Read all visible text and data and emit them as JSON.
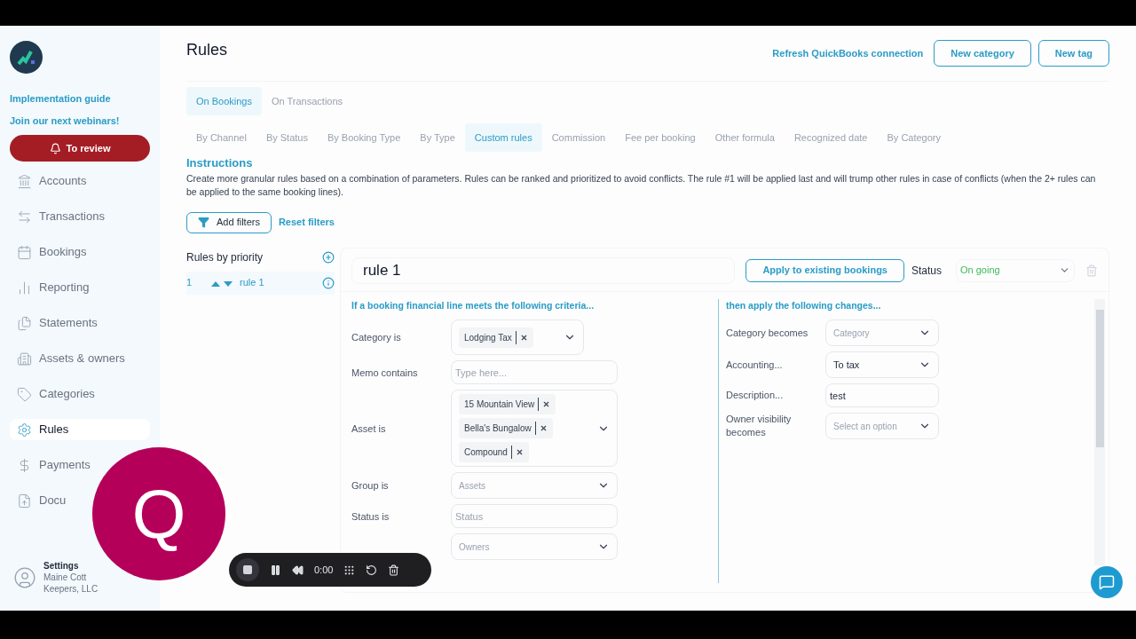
{
  "sidebar": {
    "links": [
      "Implementation guide",
      "Join our next webinars!"
    ],
    "review_button": "To review",
    "nav": [
      {
        "label": "Accounts",
        "selected": false
      },
      {
        "label": "Transactions",
        "selected": false
      },
      {
        "label": "Bookings",
        "selected": false
      },
      {
        "label": "Reporting",
        "selected": false
      },
      {
        "label": "Statements",
        "selected": false
      },
      {
        "label": "Assets & owners",
        "selected": false
      },
      {
        "label": "Categories",
        "selected": false
      },
      {
        "label": "Rules",
        "selected": true
      },
      {
        "label": "Payments",
        "selected": false
      },
      {
        "label": "Docu",
        "selected": false
      }
    ],
    "account": {
      "title": "Settings",
      "lines": [
        "Maine Cott",
        "Keepers, LLC"
      ]
    }
  },
  "header": {
    "title": "Rules",
    "refresh_link": "Refresh QuickBooks connection",
    "buttons": [
      "New category",
      "New tag"
    ]
  },
  "tabs": [
    {
      "label": "On Bookings",
      "selected": true
    },
    {
      "label": "On Transactions",
      "selected": false
    }
  ],
  "subtabs": [
    {
      "label": "By Channel",
      "selected": false
    },
    {
      "label": "By Status",
      "selected": false
    },
    {
      "label": "By Booking Type",
      "selected": false
    },
    {
      "label": "By Type",
      "selected": false
    },
    {
      "label": "Custom rules",
      "selected": true
    },
    {
      "label": "Commission",
      "selected": false
    },
    {
      "label": "Fee per booking",
      "selected": false
    },
    {
      "label": "Other formula",
      "selected": false
    },
    {
      "label": "Recognized date",
      "selected": false
    },
    {
      "label": "By Category",
      "selected": false
    }
  ],
  "instructions": {
    "title": "Instructions",
    "text": "Create more granular rules based on a combination of parameters. Rules can be ranked and prioritized to avoid conflicts. The rule #1 will be applied last and will trump other rules in case of conflicts (when the 2+ rules can be applied to the same booking lines)."
  },
  "filters": {
    "add": "Add filters",
    "reset": "Reset filters"
  },
  "rules_list": {
    "title": "Rules by priority",
    "rules": [
      {
        "rank": "1",
        "name": "rule 1",
        "selected": true
      }
    ]
  },
  "rule": {
    "name": "rule 1",
    "apply_button": "Apply to existing bookings",
    "status_label": "Status",
    "status_value": "On going",
    "criteria_title": "If a booking financial line meets the following criteria...",
    "criteria": [
      {
        "label": "Category is",
        "kind": "tags",
        "tags": [
          "Lodging Tax"
        ]
      },
      {
        "label": "Memo contains",
        "kind": "text",
        "placeholder": "Type here..."
      },
      {
        "label": "Asset is",
        "kind": "tags",
        "tags": [
          "15 Mountain View",
          "Bella's Bungalow",
          "Compound"
        ]
      },
      {
        "label": "Group is",
        "kind": "select",
        "placeholder": "Assets"
      },
      {
        "label": "Status is",
        "kind": "text",
        "placeholder": "Status"
      },
      {
        "kind": "select",
        "placeholder": "Owners"
      }
    ],
    "changes_title": "then apply the following changes...",
    "changes": [
      {
        "label": "Category becomes",
        "kind": "select",
        "placeholder": "Category"
      },
      {
        "label": "Accounting...",
        "kind": "select",
        "value": "To tax"
      },
      {
        "label": "Description...",
        "kind": "text",
        "value": "test"
      },
      {
        "label": "Owner visibility becomes",
        "kind": "select",
        "placeholder": "Select an option"
      }
    ]
  },
  "overlay": {
    "avatar_letter": "Q",
    "recorder_time": "0:00"
  }
}
